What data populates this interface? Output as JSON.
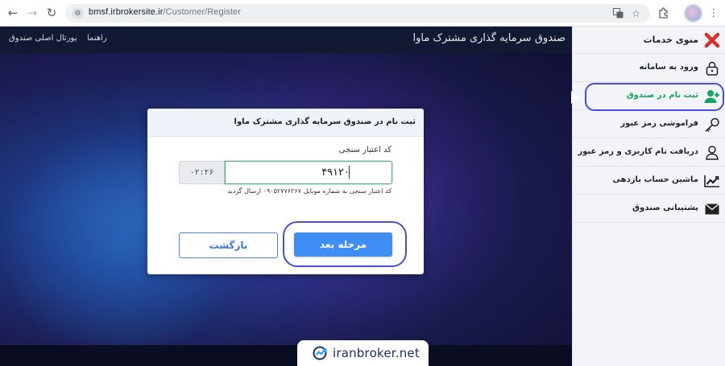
{
  "browser": {
    "url_host": "bmsf.irbrokersite.ir",
    "url_path": "/Customer/Register"
  },
  "header": {
    "title": "صندوق سرمایه گذاری مشترک ماوا",
    "help_link": "راهنما",
    "portal_link": "پورتال اصلی صندوق"
  },
  "dialog": {
    "title": "ثبت نام در صندوق سرمایه گذاری مشترک ماوا",
    "field_label": "کد اعتبار سنجی",
    "otp_value": "۴۹۱۲۰",
    "timer": "۰۲:۲۶",
    "hint": "کد اعتبار سنجی به شماره موبایل ۰۹۰۵۲۷۷۶۲۶۷ ارسال گردید",
    "next_label": "مرحله بعد",
    "back_label": "بازگشت"
  },
  "sidebar": {
    "menu_label": "منوی خدمات",
    "items": [
      {
        "label": "ورود به سامانه",
        "icon": "lock-icon"
      },
      {
        "label": "ثبت نام در صندوق",
        "icon": "add-user-icon",
        "active": true
      },
      {
        "label": "فراموشی رمز عبور",
        "icon": "key-icon"
      },
      {
        "label": "دریافت نام کاربری و رمز عبور",
        "icon": "user-icon"
      },
      {
        "label": "ماشین حساب بازدهی",
        "icon": "chart-line-icon"
      },
      {
        "label": "پشتیبانی صندوق",
        "icon": "envelope-icon"
      }
    ]
  },
  "watermark": {
    "text": "iranbroker.net"
  },
  "colors": {
    "accent": "#3f8ef5",
    "active_green": "#16a560",
    "highlight_ring": "#4a4ed6",
    "close_red": "#d9302b"
  }
}
